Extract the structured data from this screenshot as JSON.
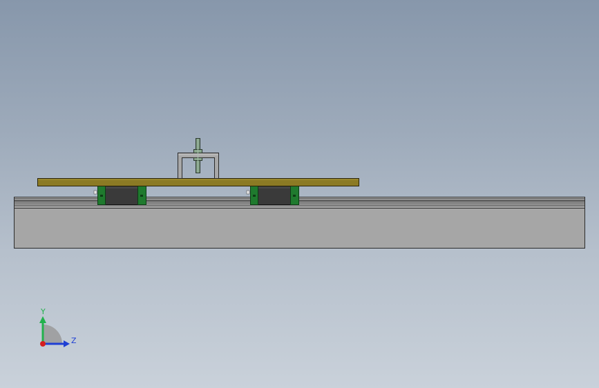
{
  "viewport": {
    "background_top": "#8797ab",
    "background_bottom": "#c9d1da"
  },
  "model": {
    "base_color": "#a6a6a6",
    "rail_color": "#b4b4b4",
    "carriage_plate_color": "#8b7a24",
    "bearing_block_color": "#3a3a3a",
    "bearing_seal_color": "#1f7a2e",
    "bracket_color": "#a8a8a8",
    "screw_color": "#7e9b82"
  },
  "triad": {
    "y_label": "Y",
    "z_label": "Z",
    "y_color": "#22b14c",
    "z_color": "#1f3fd4",
    "x_color": "#d41f1f"
  }
}
